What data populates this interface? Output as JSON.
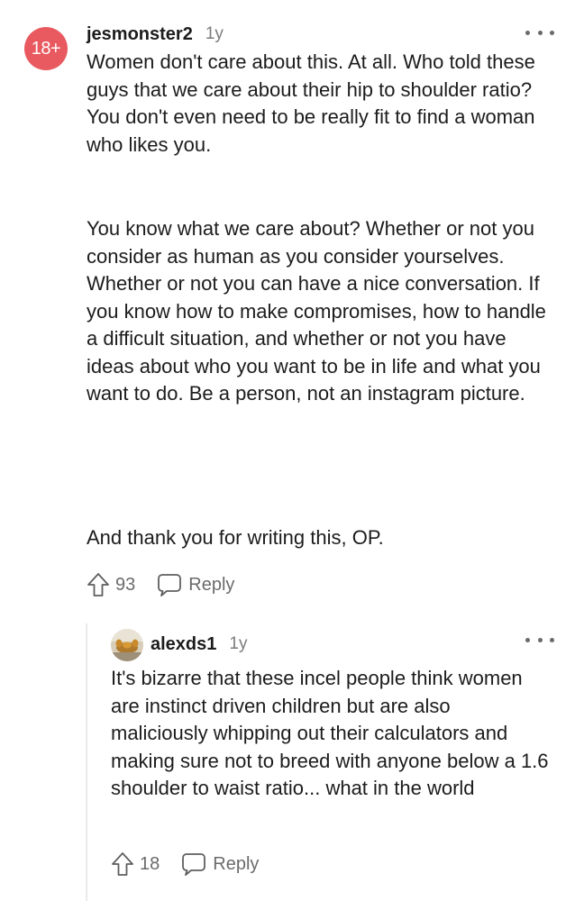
{
  "parent_comment": {
    "avatar_text": "18+",
    "username": "jesmonster2",
    "age": "1y",
    "paragraphs": [
      "Women don't care about this. At all. Who told these guys that we care about their hip to shoulder ratio? You don't even need to be really fit to find a woman who likes you.",
      "You know what we care about? Whether or not you consider as human as you consider yourselves. Whether or not you can have a nice conversation. If you know how to make compromises, how to handle a difficult situation, and whether or not you have ideas about who you want to be in life and what you want to do. Be a person, not an instagram picture.",
      "And thank you for writing this, OP."
    ],
    "votes": "93",
    "reply_label": "Reply"
  },
  "reply_comment": {
    "username": "alexds1",
    "age": "1y",
    "body": "It's bizarre that these incel people think women are instinct driven children but are also maliciously whipping out their calculators and making sure not to breed with anyone below a 1.6 shoulder to waist ratio... what in the world",
    "votes": "18",
    "reply_label": "Reply"
  },
  "icons": {
    "upvote": "upvote-arrow-icon",
    "reply": "speech-bubble-icon",
    "more": "more-options-icon"
  },
  "colors": {
    "nsfw_avatar": "#e85a5f",
    "meta_gray": "#7c7c7c",
    "text": "#1c1c1c",
    "thread_line": "#ebebeb"
  }
}
